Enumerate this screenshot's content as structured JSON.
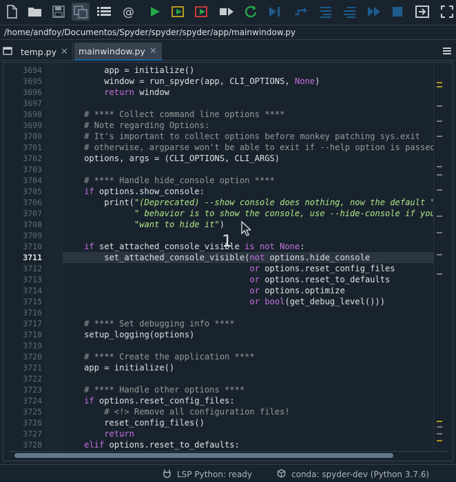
{
  "toolbar": {
    "icons": [
      "new-file-icon",
      "open-file-icon",
      "save-icon",
      "save-all-icon",
      "outline-icon",
      "at-icon",
      "run-icon",
      "run-cell-icon",
      "run-cell-advance-icon",
      "run-selection-icon",
      "rerun-icon",
      "debug-icon",
      "step-icon",
      "step-into-icon",
      "step-return-icon",
      "continue-icon",
      "stop-icon",
      "maximize-pane-icon",
      "fullscreen-icon"
    ]
  },
  "path_bar": {
    "path": "/home/andfoy/Documentos/Spyder/spyder/spyder/app/mainwindow.py"
  },
  "tabs": [
    {
      "label": "temp.py",
      "close": "✕"
    },
    {
      "label": "mainwindow.py",
      "close": "✕"
    }
  ],
  "editor": {
    "current_line": "3711",
    "line_numbers": [
      "3694",
      "3695",
      "3696",
      "3697",
      "3698",
      "3699",
      "3700",
      "3701",
      "3702",
      "3703",
      "3704",
      "3705",
      "3706",
      "3707",
      "3708",
      "3709",
      "3710",
      "3711",
      "3712",
      "3713",
      "3714",
      "3715",
      "3716",
      "3717",
      "3718",
      "3719",
      "3720",
      "3721",
      "3722",
      "3723",
      "3724",
      "3725",
      "3726",
      "3727",
      "3728"
    ],
    "lines": [
      [
        [
          "n",
          "        app = initialize()"
        ]
      ],
      [
        [
          "n",
          "        window = run_spyder(app, CLI_OPTIONS, "
        ],
        [
          "k",
          "None"
        ],
        [
          "n",
          ")"
        ]
      ],
      [
        [
          "n",
          "        "
        ],
        [
          "k",
          "return"
        ],
        [
          "n",
          " window"
        ]
      ],
      [
        [
          "n",
          ""
        ]
      ],
      [
        [
          "c",
          "    # **** Collect command line options ****"
        ]
      ],
      [
        [
          "c",
          "    # Note regarding Options:"
        ]
      ],
      [
        [
          "c",
          "    # It's important to collect options before monkey patching sys.exit"
        ]
      ],
      [
        [
          "c",
          "    # otherwise, argparse won't be able to exit if --help option is passed"
        ]
      ],
      [
        [
          "n",
          "    options, args = (CLI_OPTIONS, CLI_ARGS)"
        ]
      ],
      [
        [
          "n",
          ""
        ]
      ],
      [
        [
          "c",
          "    # **** Handle hide_console option ****"
        ]
      ],
      [
        [
          "k",
          "    if"
        ],
        [
          "n",
          " options.show_console:"
        ]
      ],
      [
        [
          "n",
          "        print("
        ],
        [
          "s",
          "\"(Deprecated) --show console does nothing, now the default \""
        ]
      ],
      [
        [
          "s",
          "              \" behavior is to show the console, use --hide-console if you \""
        ]
      ],
      [
        [
          "s",
          "              \"want to hide it\""
        ],
        [
          "n",
          ")"
        ]
      ],
      [
        [
          "n",
          ""
        ]
      ],
      [
        [
          "k",
          "    if"
        ],
        [
          "n",
          " set_attached_console_visible "
        ],
        [
          "k",
          "is not"
        ],
        [
          "n",
          " "
        ],
        [
          "k",
          "None"
        ],
        [
          "n",
          ":"
        ]
      ],
      [
        [
          "n",
          "        set_attached_console_visible("
        ],
        [
          "k",
          "not"
        ],
        [
          "n",
          " options.hide_console"
        ]
      ],
      [
        [
          "n",
          "                                     "
        ],
        [
          "k",
          "or"
        ],
        [
          "n",
          " options.reset_config_files"
        ]
      ],
      [
        [
          "n",
          "                                     "
        ],
        [
          "k",
          "or"
        ],
        [
          "n",
          " options.reset_to_defaults"
        ]
      ],
      [
        [
          "n",
          "                                     "
        ],
        [
          "k",
          "or"
        ],
        [
          "n",
          " options.optimize"
        ]
      ],
      [
        [
          "n",
          "                                     "
        ],
        [
          "k",
          "or"
        ],
        [
          "n",
          " "
        ],
        [
          "k",
          "bool"
        ],
        [
          "n",
          "(get_debug_level()))"
        ]
      ],
      [
        [
          "n",
          ""
        ]
      ],
      [
        [
          "c",
          "    # **** Set debugging info ****"
        ]
      ],
      [
        [
          "n",
          "    setup_logging(options)"
        ]
      ],
      [
        [
          "n",
          ""
        ]
      ],
      [
        [
          "c",
          "    # **** Create the application ****"
        ]
      ],
      [
        [
          "n",
          "    app = initialize()"
        ]
      ],
      [
        [
          "n",
          ""
        ]
      ],
      [
        [
          "c",
          "    # **** Handle other options ****"
        ]
      ],
      [
        [
          "k",
          "    if"
        ],
        [
          "n",
          " options.reset_config_files:"
        ]
      ],
      [
        [
          "c",
          "        # <!> Remove all configuration files!"
        ]
      ],
      [
        [
          "n",
          "        reset_config_files()"
        ]
      ],
      [
        [
          "n",
          "        "
        ],
        [
          "k",
          "return"
        ]
      ],
      [
        [
          "k",
          "    elif"
        ],
        [
          "n",
          " options.reset_to_defaults:"
        ]
      ]
    ]
  },
  "overlay": {
    "step_number": "1"
  },
  "status_bar": {
    "lsp": "LSP Python: ready",
    "conda": "conda: spyder-dev (Python 3.7.6)"
  },
  "colors": {
    "keyword": "#c670e0",
    "comment": "#999999",
    "string": "#b0e686",
    "text": "#e0e1e3",
    "accent": "#1464a0"
  }
}
